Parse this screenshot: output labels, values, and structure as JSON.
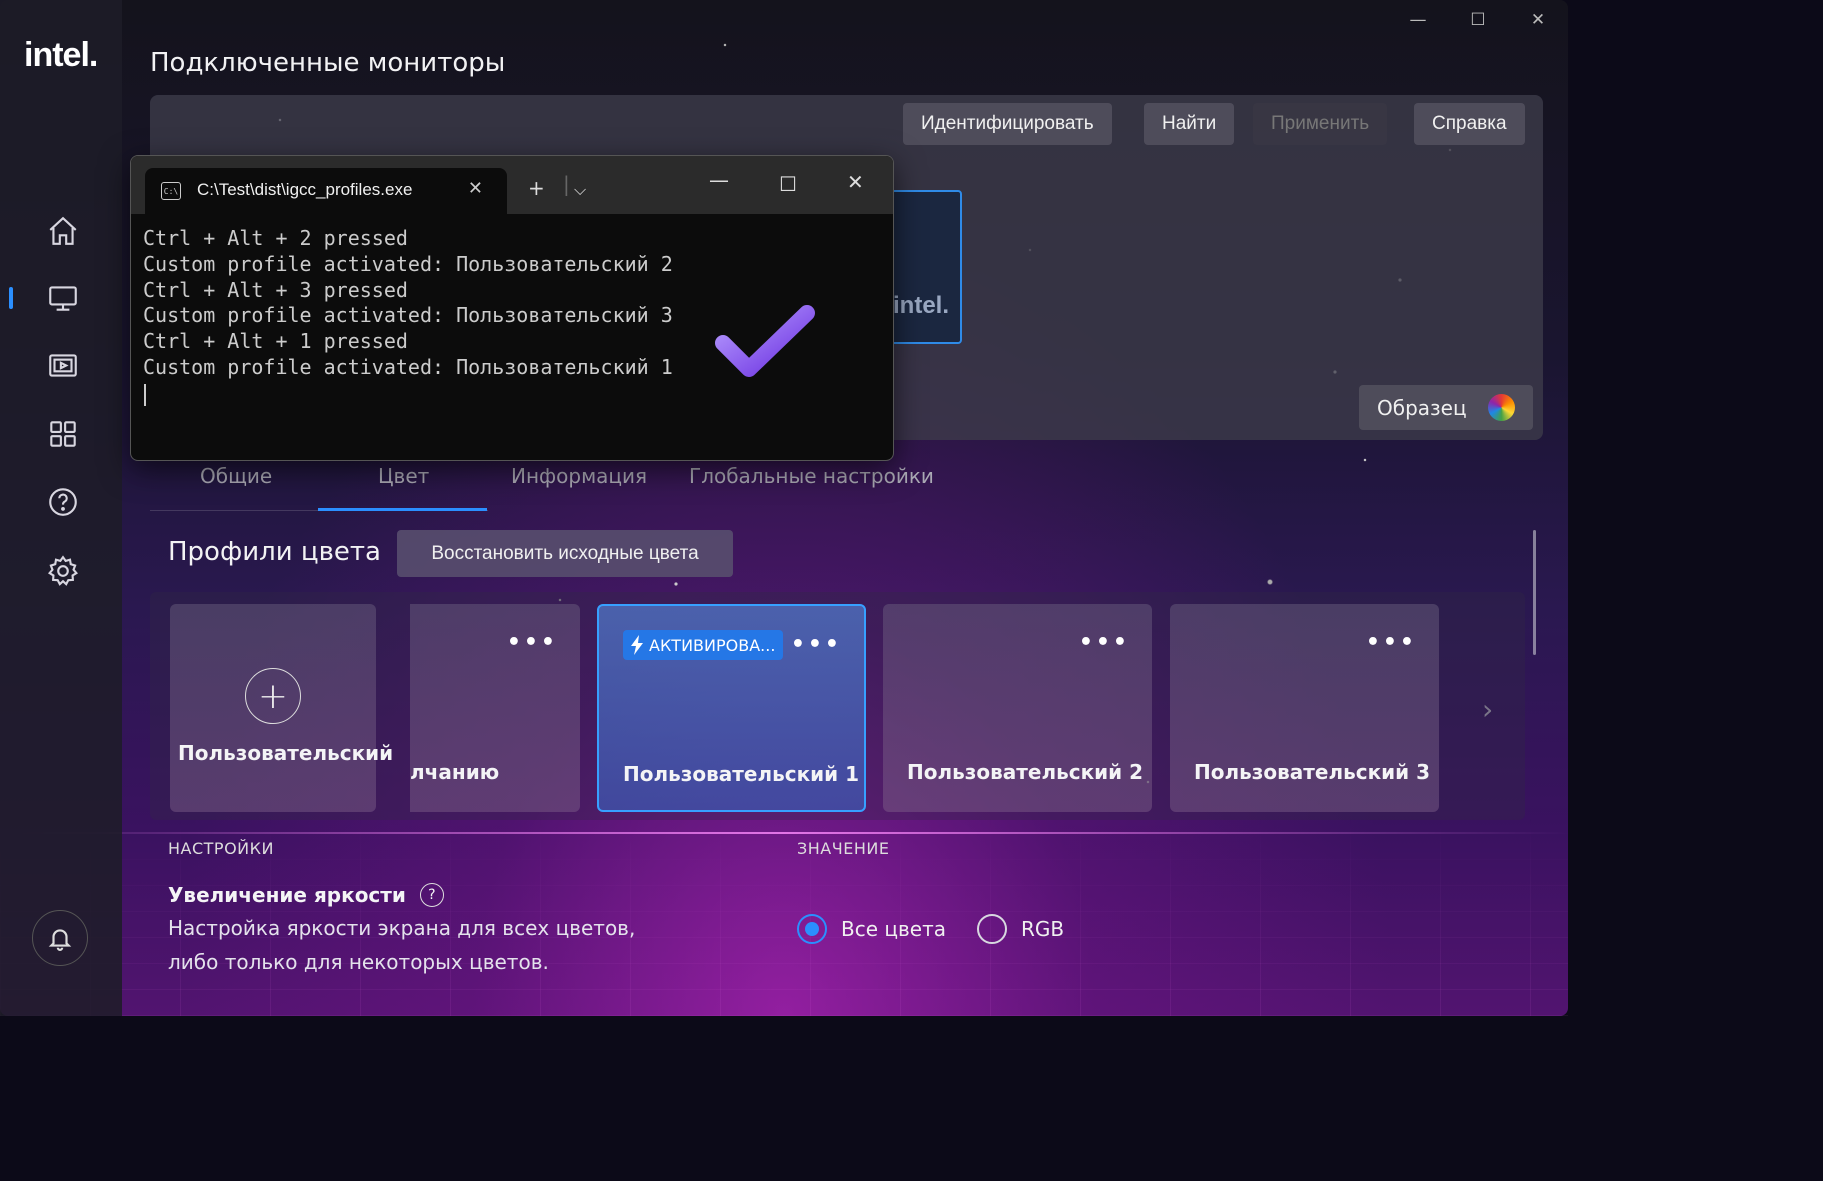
{
  "window": {
    "minimize_glyph": "—",
    "maximize_glyph": "☐",
    "close_glyph": "✕"
  },
  "sidebar": {
    "logo": "intel.",
    "items": [
      {
        "icon": "home-icon"
      },
      {
        "icon": "monitor-icon",
        "active": true
      },
      {
        "icon": "video-icon"
      },
      {
        "icon": "apps-grid-icon"
      },
      {
        "icon": "help-icon"
      },
      {
        "icon": "settings-gear-icon"
      }
    ],
    "bell_icon": "bell-icon",
    "accent": "#2b8fff"
  },
  "header": {
    "title": "Подключенные мониторы"
  },
  "toolbar": {
    "identify": "Идентифицировать",
    "find": "Найти",
    "apply": "Применить",
    "help": "Справка"
  },
  "monitor": {
    "logo": "intel."
  },
  "sample": {
    "label": "Образец"
  },
  "terminal": {
    "tab_title": "C:\\Test\\dist\\igcc_profiles.exe",
    "tab_icon_text": "C:\\",
    "lines": [
      "Ctrl + Alt + 2 pressed",
      "Custom profile activated: Пользовательский 2",
      "Ctrl + Alt + 3 pressed",
      "Custom profile activated: Пользовательский 3",
      "Ctrl + Alt + 1 pressed",
      "Custom profile activated: Пользовательский 1"
    ]
  },
  "tabs": [
    {
      "label": "Общие"
    },
    {
      "label": "Цвет",
      "active": true
    },
    {
      "label": "Информация"
    },
    {
      "label": "Глобальные настройки"
    }
  ],
  "profiles": {
    "heading": "Профили цвета",
    "restore_button": "Восстановить исходные цвета",
    "add_card_label": "Пользовательский",
    "cards": [
      {
        "name": "лчанию",
        "menu": "•••"
      },
      {
        "name": "Пользовательский 1",
        "menu": "•••",
        "badge": "АКТИВИРОВА...",
        "active": true
      },
      {
        "name": "Пользовательский 2",
        "menu": "•••"
      },
      {
        "name": "Пользовательский 3",
        "menu": "•••"
      }
    ]
  },
  "settings": {
    "section_label": "НАСТРОЙКИ",
    "value_label": "ЗНАЧЕНИЕ",
    "brightness_title": "Увеличение яркости",
    "brightness_desc": "Настройка яркости экрана для всех цветов, либо только для некоторых цветов.",
    "options": [
      {
        "label": "Все цвета",
        "checked": true
      },
      {
        "label": "RGB",
        "checked": false
      }
    ]
  }
}
